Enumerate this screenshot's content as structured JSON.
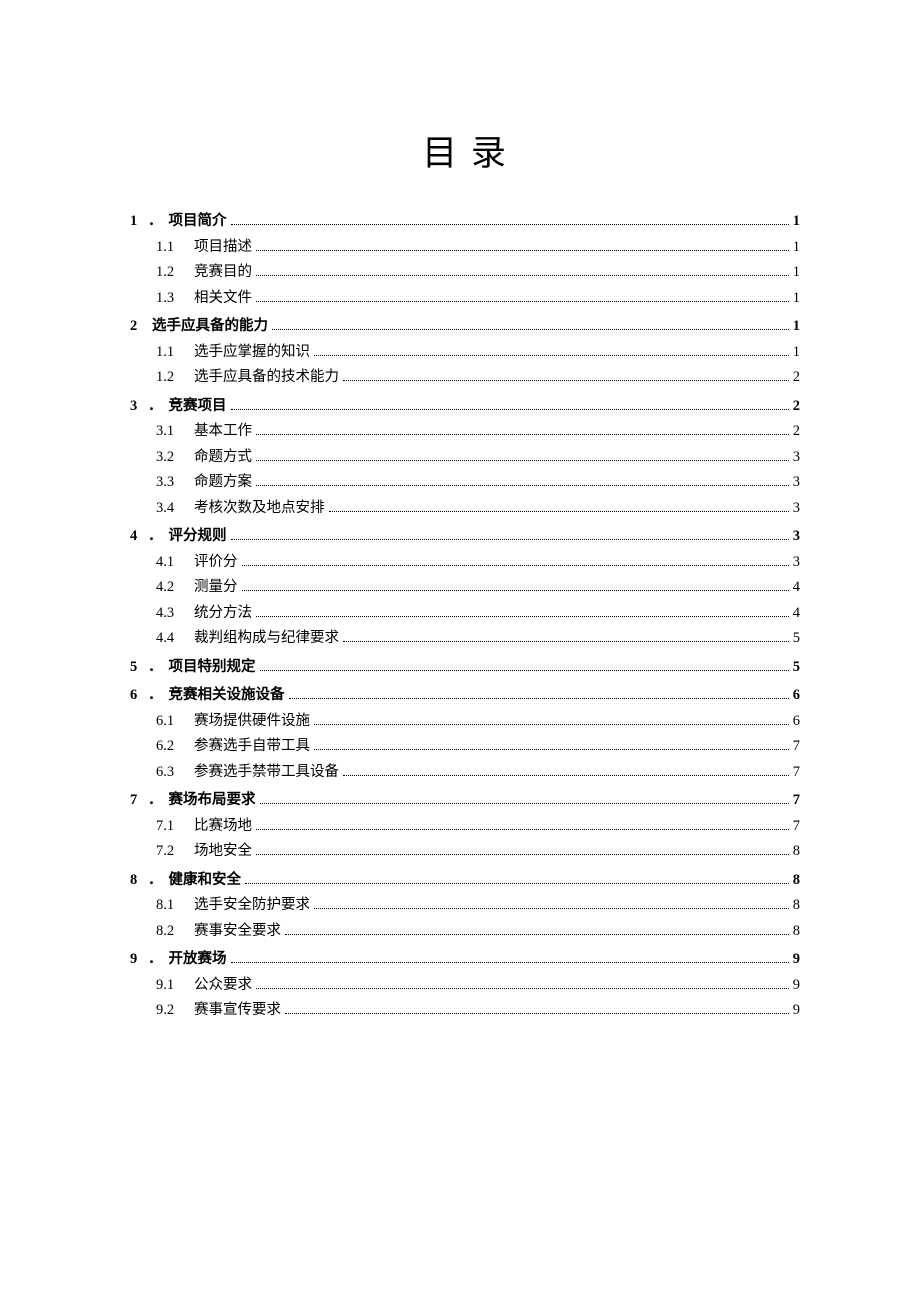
{
  "title": "目 录",
  "toc": [
    {
      "level": 1,
      "num": "1",
      "punct": "．",
      "label": "项目简介",
      "page": "1"
    },
    {
      "level": 2,
      "num": "1.1",
      "label": "项目描述",
      "page": "1"
    },
    {
      "level": 2,
      "num": "1.2",
      "label": "竞赛目的",
      "page": "1"
    },
    {
      "level": 2,
      "num": "1.3",
      "label": "相关文件",
      "page": "1"
    },
    {
      "level": 1,
      "num": "2",
      "punct": "",
      "label": "选手应具备的能力",
      "page": "1"
    },
    {
      "level": 2,
      "num": "1.1",
      "label": "选手应掌握的知识",
      "page": "1"
    },
    {
      "level": 2,
      "num": "1.2",
      "label": "选手应具备的技术能力",
      "page": "2"
    },
    {
      "level": 1,
      "num": "3",
      "punct": "．",
      "label": "竞赛项目",
      "page": "2"
    },
    {
      "level": 2,
      "num": "3.1",
      "label": "基本工作",
      "page": "2"
    },
    {
      "level": 2,
      "num": "3.2",
      "label": "命题方式",
      "page": "3"
    },
    {
      "level": 2,
      "num": "3.3",
      "label": "命题方案",
      "page": "3"
    },
    {
      "level": 2,
      "num": "3.4",
      "label": "考核次数及地点安排",
      "page": "3"
    },
    {
      "level": 1,
      "num": "4",
      "punct": "．",
      "label": "评分规则",
      "page": "3"
    },
    {
      "level": 2,
      "num": "4.1",
      "label": "评价分",
      "page": "3"
    },
    {
      "level": 2,
      "num": "4.2",
      "label": "测量分",
      "page": "4"
    },
    {
      "level": 2,
      "num": "4.3",
      "label": "统分方法",
      "page": "4"
    },
    {
      "level": 2,
      "num": "4.4",
      "label": "裁判组构成与纪律要求",
      "page": "5"
    },
    {
      "level": 1,
      "num": "5",
      "punct": "．",
      "label": "项目特别规定",
      "page": "5"
    },
    {
      "level": 1,
      "num": "6",
      "punct": "．",
      "label": "竞赛相关设施设备",
      "page": "6"
    },
    {
      "level": 2,
      "num": "6.1",
      "label": "赛场提供硬件设施",
      "page": "6"
    },
    {
      "level": 2,
      "num": "6.2",
      "label": "参赛选手自带工具",
      "page": "7"
    },
    {
      "level": 2,
      "num": "6.3",
      "label": "参赛选手禁带工具设备",
      "page": "7"
    },
    {
      "level": 1,
      "num": "7",
      "punct": "．",
      "label": "赛场布局要求",
      "page": "7"
    },
    {
      "level": 2,
      "num": "7.1",
      "label": "比赛场地",
      "page": "7"
    },
    {
      "level": 2,
      "num": "7.2",
      "label": "场地安全",
      "page": "8"
    },
    {
      "level": 1,
      "num": "8",
      "punct": "．",
      "label": "健康和安全",
      "page": "8"
    },
    {
      "level": 2,
      "num": "8.1",
      "label": "选手安全防护要求",
      "page": "8"
    },
    {
      "level": 2,
      "num": "8.2",
      "label": "赛事安全要求",
      "page": "8"
    },
    {
      "level": 1,
      "num": "9",
      "punct": "．",
      "label": "开放赛场",
      "page": "9"
    },
    {
      "level": 2,
      "num": "9.1",
      "label": "公众要求",
      "page": "9"
    },
    {
      "level": 2,
      "num": "9.2",
      "label": "赛事宣传要求",
      "page": "9"
    }
  ]
}
